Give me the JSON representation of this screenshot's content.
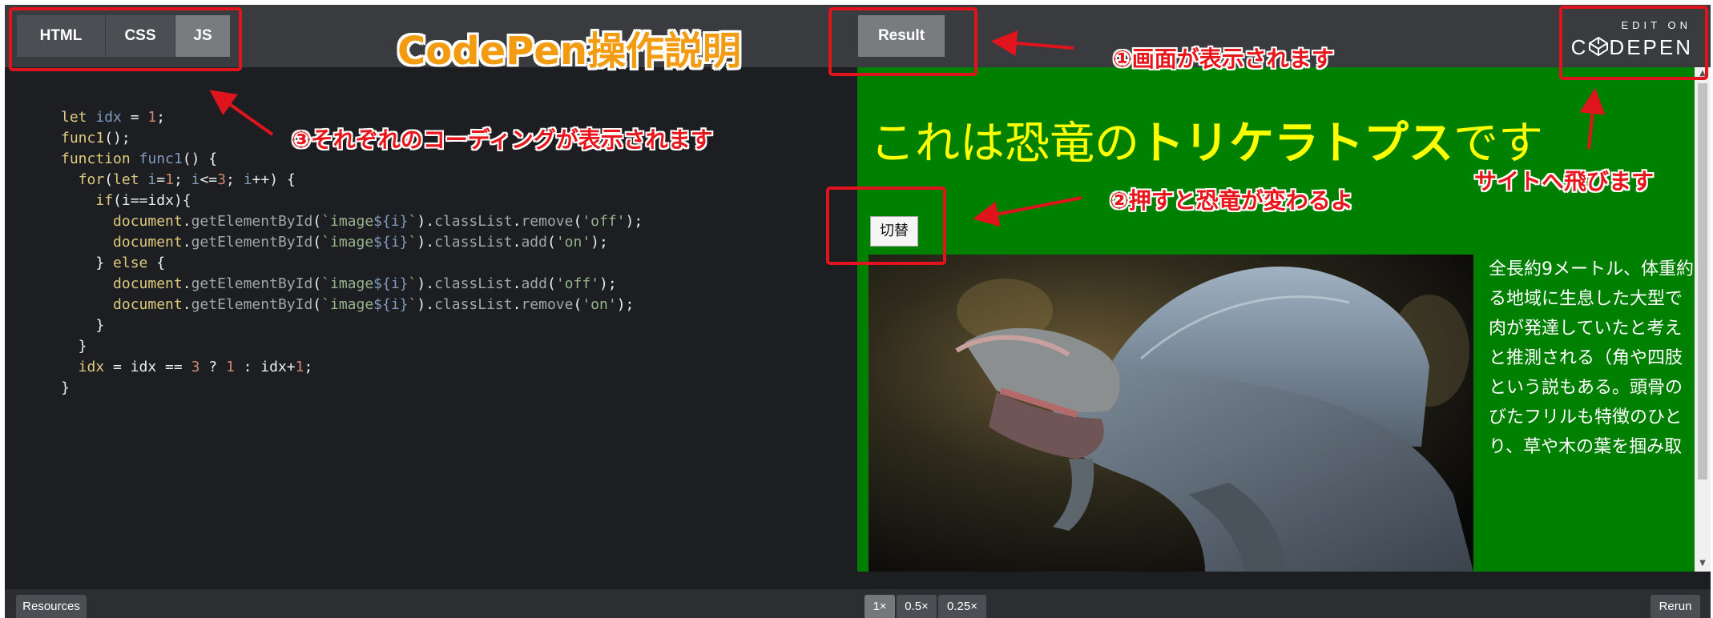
{
  "editor_tabs": [
    {
      "label": "HTML",
      "active": false
    },
    {
      "label": "CSS",
      "active": false
    },
    {
      "label": "JS",
      "active": true
    }
  ],
  "result_tab": "Result",
  "codepen_link": {
    "small": "EDIT ON",
    "big_before": "C",
    "big_after": "DEPEN"
  },
  "code_lines": [
    "let idx = 1;",
    "func1();",
    "function func1() {",
    "  for(let i=1; i<=3; i++) {",
    "    if(i==idx){",
    "      document.getElementById(`image${i}`).classList.remove('off');",
    "      document.getElementById(`image${i}`).classList.add('on');",
    "    } else {",
    "      document.getElementById(`image${i}`).classList.add('off');",
    "      document.getElementById(`image${i}`).classList.remove('on');",
    "    }",
    "  }",
    "  idx = idx == 3 ? 1 : idx+1;",
    "}"
  ],
  "result": {
    "heading_before": "これは恐竜の",
    "heading_bold": "トリケラトプス",
    "heading_after": "です",
    "switch_button": "切替",
    "description_lines": [
      "全長約9メートル、体重約",
      "る地域に生息した大型で",
      "肉が発達していたと考え",
      "と推測される（角や四肢",
      "という説もある。頭骨の",
      "びたフリルも特徴のひと",
      "り、草や木の葉を掴み取"
    ]
  },
  "bottom_bar": {
    "resources": "Resources",
    "zoom": [
      {
        "label": "1×",
        "active": true
      },
      {
        "label": "0.5×",
        "active": false
      },
      {
        "label": "0.25×",
        "active": false
      }
    ],
    "rerun": "Rerun"
  },
  "annotations": {
    "title": "CodePen操作説明",
    "a1": "①画面が表示されます",
    "a2": "②押すと恐竜が変わるよ",
    "a3": "③それぞれのコーディングが表示されます",
    "a4": "サイトへ飛びます"
  },
  "colors": {
    "annotation_red": "#e0141c",
    "title_orange": "#f39c12",
    "result_green": "#008000",
    "heading_yellow": "#ffff00",
    "editor_bg": "#1d1e22"
  }
}
